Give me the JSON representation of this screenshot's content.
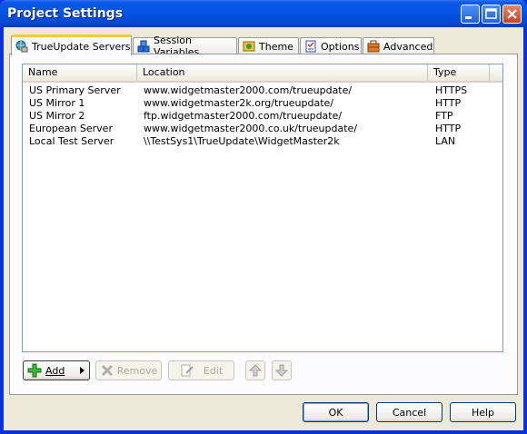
{
  "window": {
    "title": "Project Settings"
  },
  "tabs": [
    {
      "label": "TrueUpdate Servers",
      "icon": "globe-server-icon"
    },
    {
      "label": "Session Variables",
      "icon": "blocks-icon"
    },
    {
      "label": "Theme",
      "icon": "theme-icon"
    },
    {
      "label": "Options",
      "icon": "checklist-icon"
    },
    {
      "label": "Advanced",
      "icon": "toolbox-icon"
    }
  ],
  "list": {
    "columns": [
      "Name",
      "Location",
      "Type"
    ],
    "rows": [
      {
        "name": "US Primary Server",
        "location": "www.widgetmaster2000.com/trueupdate/",
        "type": "HTTPS"
      },
      {
        "name": "US Mirror 1",
        "location": "www.widgetmaster2k.org/trueupdate/",
        "type": "HTTP"
      },
      {
        "name": "US Mirror 2",
        "location": "ftp.widgetmaster2000.com/trueupdate/",
        "type": "FTP"
      },
      {
        "name": "European Server",
        "location": "www.widgetmaster2000.co.uk/trueupdate/",
        "type": "HTTP"
      },
      {
        "name": "Local Test Server",
        "location": "\\\\TestSys1\\TrueUpdate\\WidgetMaster2k",
        "type": "LAN"
      }
    ]
  },
  "toolbar": {
    "add_label": "Add",
    "remove_label": "Remove",
    "edit_label": "Edit"
  },
  "footer": {
    "ok_label": "OK",
    "cancel_label": "Cancel",
    "help_label": "Help"
  },
  "colors": {
    "title_bar": "#0554e3",
    "active_tab_highlight": "#ffc83c",
    "dialog_bg": "#ece9d8"
  }
}
